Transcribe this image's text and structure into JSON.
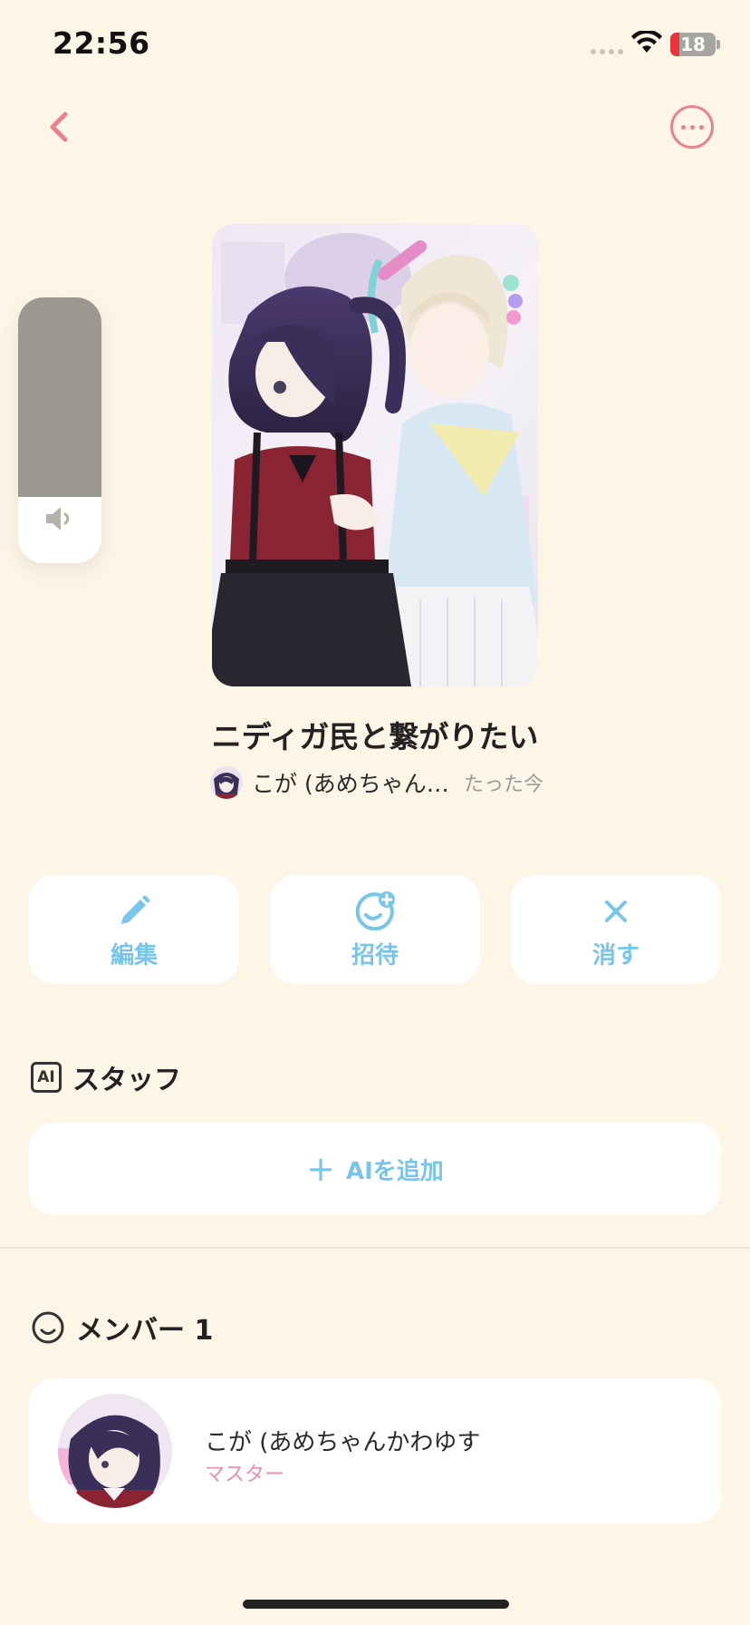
{
  "status_bar": {
    "time": "22:56",
    "battery": "18",
    "battery_color": "#e8343a"
  },
  "nav": {
    "back_icon": "chevron-left-icon",
    "more_icon": "ellipsis-circle-icon"
  },
  "volume_hud": {
    "level": 0.75,
    "icon": "speaker-icon"
  },
  "group": {
    "title": "ニディガ民と繋がりたい",
    "owner_name": "こが (あめちゃん…",
    "time": "たった今"
  },
  "actions": [
    {
      "label": "編集",
      "icon": "pencil-icon"
    },
    {
      "label": "招待",
      "icon": "add-smile-icon"
    },
    {
      "label": "消す",
      "icon": "close-icon"
    }
  ],
  "staff": {
    "badge": "AI",
    "title": "スタッフ",
    "add_label": "AIを追加"
  },
  "members": {
    "title": "メンバー 1",
    "items": [
      {
        "name": "こが (あめちゃんかわゆす",
        "role": "マスター"
      }
    ]
  },
  "colors": {
    "background": "#fdf6e6",
    "accent_blue": "#78c5ea",
    "accent_pink": "#e9828f",
    "role_pink": "#ea8fb0"
  }
}
